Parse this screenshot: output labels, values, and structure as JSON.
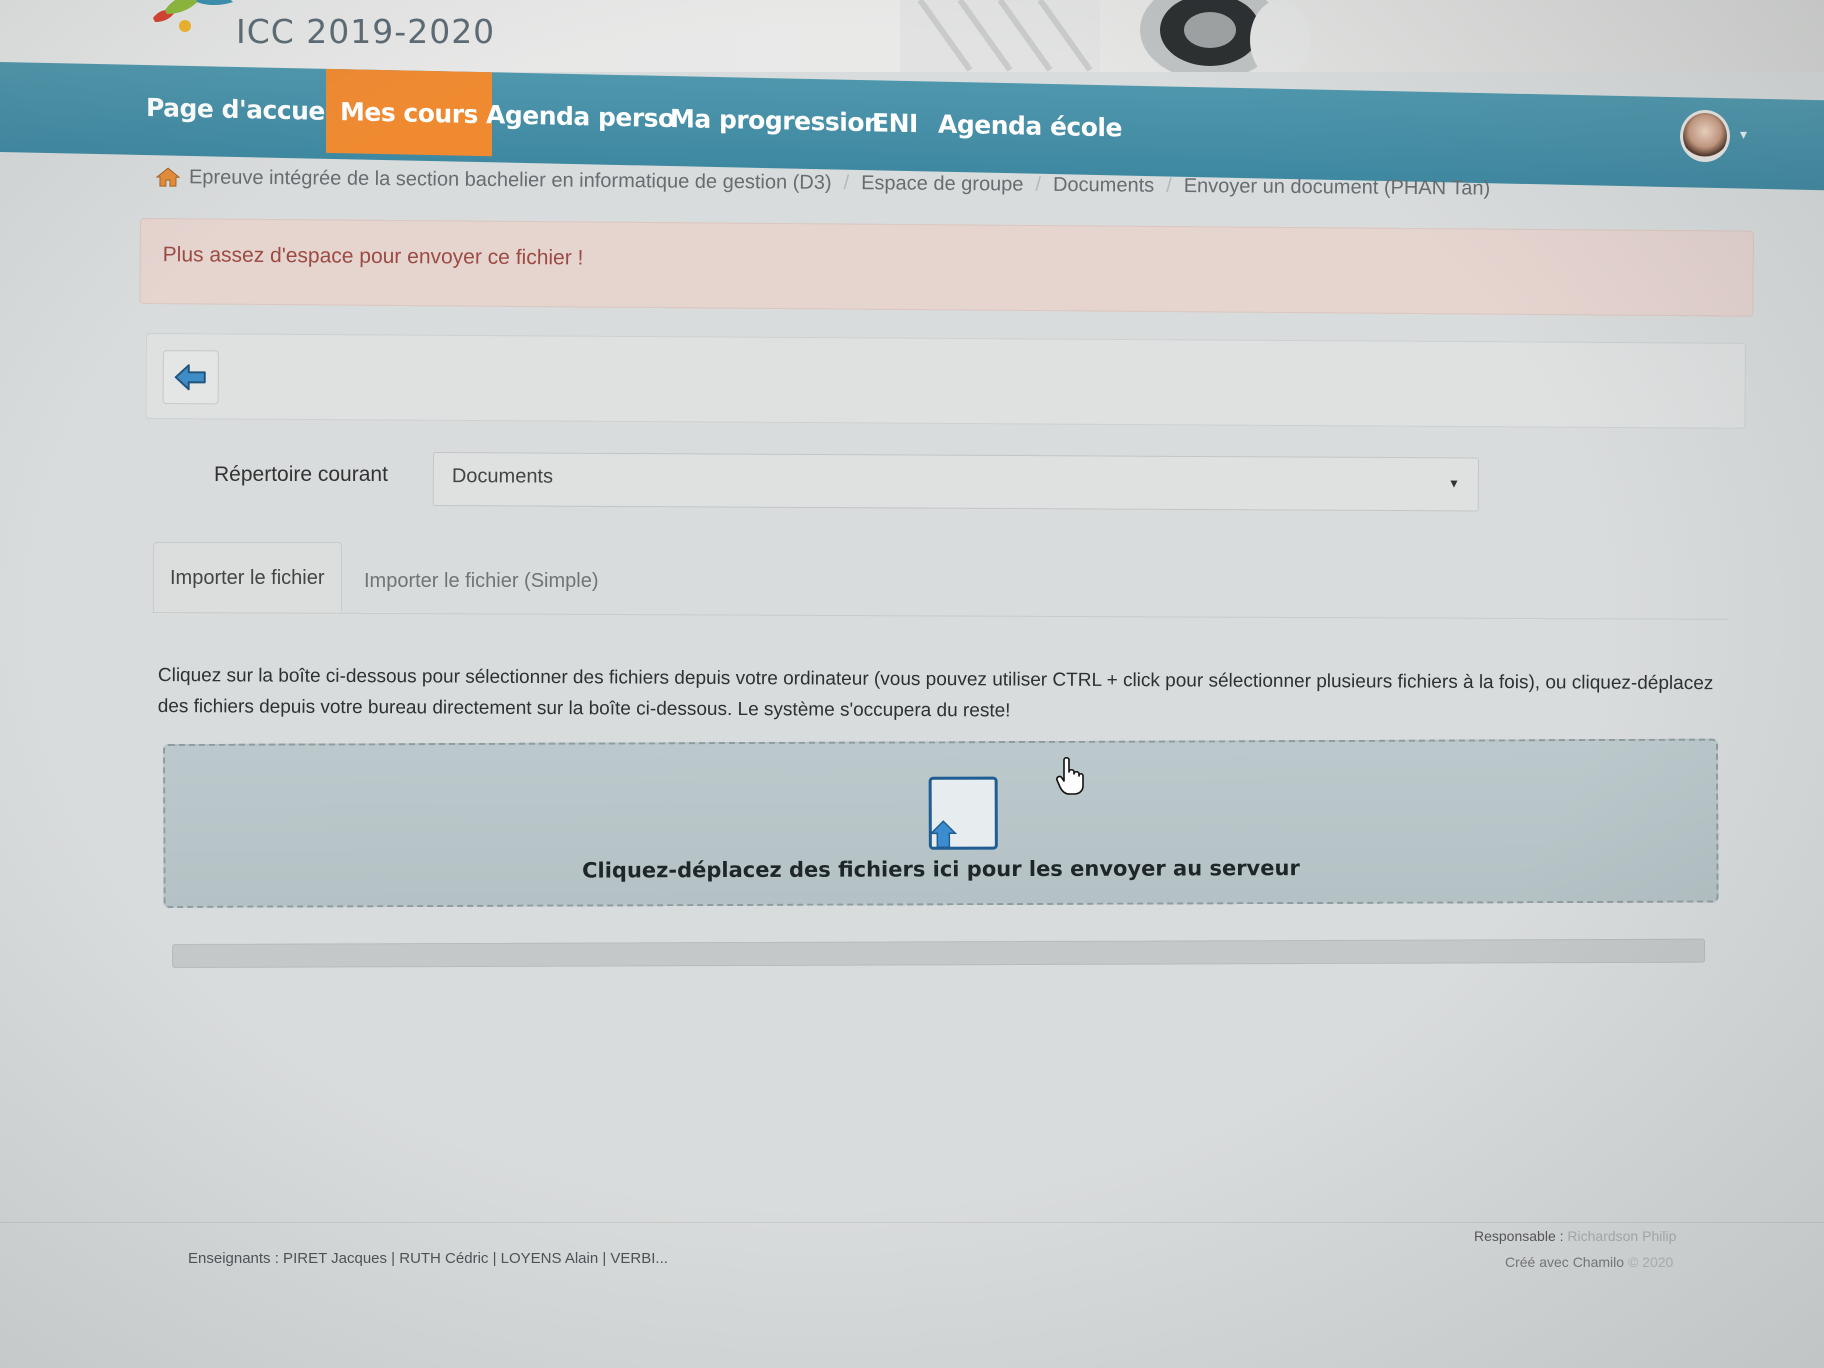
{
  "header": {
    "site_title": "ICC 2019-2020"
  },
  "nav": {
    "items": [
      {
        "label": "Page d'accueil"
      },
      {
        "label": "Mes cours"
      },
      {
        "label": "Agenda perso"
      },
      {
        "label": "Ma progression"
      },
      {
        "label": "ENI"
      },
      {
        "label": "Agenda école"
      }
    ],
    "active": "Mes cours",
    "active_color": "#ef8a31",
    "bar_color": "#3e88a1"
  },
  "breadcrumb": {
    "items": [
      {
        "label": "Epreuve intégrée de la section bachelier en informatique de gestion (D3)"
      },
      {
        "label": "Espace de groupe"
      },
      {
        "label": "Documents"
      },
      {
        "label": "Envoyer un document (PHAN Tan)"
      }
    ],
    "separator": "/"
  },
  "alert": {
    "message": "Plus assez d'espace pour envoyer ce fichier !"
  },
  "form": {
    "directory_label": "Répertoire courant",
    "directory_value": "Documents"
  },
  "tabs": [
    {
      "label": "Importer le fichier"
    },
    {
      "label": "Importer le fichier (Simple)"
    }
  ],
  "instructions": "Cliquez sur la boîte ci-dessous pour sélectionner des fichiers depuis votre ordinateur (vous pouvez utiliser CTRL + click pour sélectionner plusieurs fichiers à la fois), ou cliquez-déplacez des fichiers depuis votre bureau directement sur la boîte ci-dessous. Le système s'occupera du reste!",
  "dropzone": {
    "text": "Cliquez-déplacez des fichiers ici pour les envoyer au serveur"
  },
  "upload_progress": 0,
  "footer": {
    "teachers": "Enseignants : PIRET Jacques | RUTH Cédric | LOYENS Alain | VERBI...",
    "responsable_label": "Responsable :",
    "responsable_name": "Richardson Philip",
    "created_label": "Créé avec Chamilo",
    "created_year": "© 2020"
  }
}
